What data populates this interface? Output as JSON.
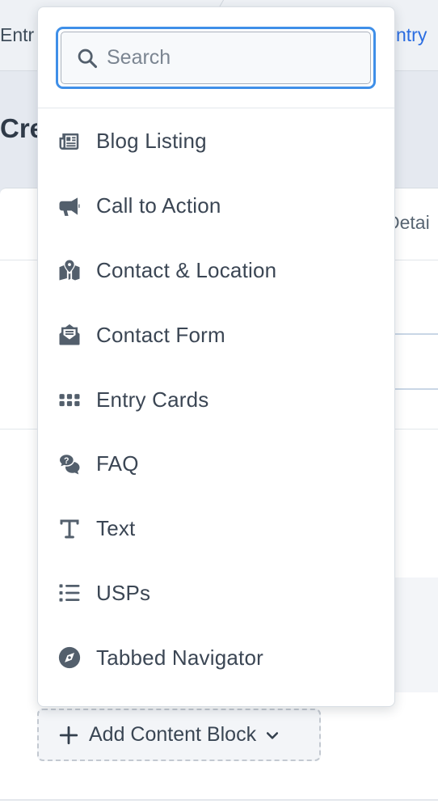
{
  "breadcrumb": {
    "left_text": "Entr",
    "right_text": "ntry"
  },
  "page": {
    "title_partial": "Cre"
  },
  "tabs": {
    "details_partial": "Detai"
  },
  "search": {
    "placeholder": "Search",
    "value": ""
  },
  "menu": {
    "items": [
      {
        "label": "Blog Listing",
        "icon": "newspaper-icon"
      },
      {
        "label": "Call to Action",
        "icon": "megaphone-icon"
      },
      {
        "label": "Contact & Location",
        "icon": "map-location-icon"
      },
      {
        "label": "Contact Form",
        "icon": "envelope-open-icon"
      },
      {
        "label": "Entry Cards",
        "icon": "grid-dots-icon"
      },
      {
        "label": "FAQ",
        "icon": "chat-question-icon"
      },
      {
        "label": "Text",
        "icon": "text-t-icon"
      },
      {
        "label": "USPs",
        "icon": "list-icon"
      },
      {
        "label": "Tabbed Navigator",
        "icon": "compass-icon"
      }
    ]
  },
  "add_block": {
    "label": "Add Content Block"
  },
  "colors": {
    "accent": "#3f8fe8",
    "link": "#2b6de1",
    "icon": "#535f6c",
    "text": "#3b4654"
  }
}
